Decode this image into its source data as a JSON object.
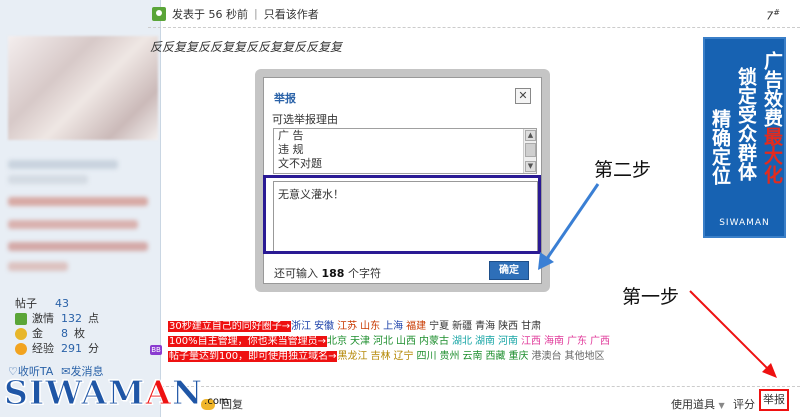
{
  "post": {
    "time_label": "发表于 56 秒前",
    "author_only": "只看该作者",
    "floor": "7",
    "floor_suffix": "#",
    "content": "反反复复反反复复反反复复反反复复"
  },
  "user": {
    "stats": [
      {
        "label": "帖子",
        "value": "43",
        "unit": "",
        "icon": "none"
      },
      {
        "label": "激情",
        "value": "132",
        "unit": "点",
        "icon": "sprout-icon"
      },
      {
        "label": "金",
        "value": "8",
        "unit": "枚",
        "icon": "gold-coin-icon"
      },
      {
        "label": "经验",
        "value": "291",
        "unit": "分",
        "icon": "experience-icon"
      }
    ],
    "collect_label": "收听TA",
    "message_label": "发消息"
  },
  "dialog": {
    "title": "举报",
    "close": "✕",
    "hint": "可选举报理由",
    "reasons": [
      "广 告",
      "违 规",
      "文不对题"
    ],
    "comment": "无意义灌水！",
    "remaining_prefix": "还可输入",
    "remaining_count": "188",
    "remaining_suffix": "个字符",
    "confirm": "确定"
  },
  "annotations": {
    "step2": "第二步",
    "step1": "第一步"
  },
  "ad": {
    "col_left": "精确定位",
    "col_mid": "锁定受众群体",
    "col_right_a": "广告效费",
    "col_right_b": "最大化",
    "brand": "SIWAMAN"
  },
  "promo": {
    "line1_tag": "30秒建立自己的同好圈子→",
    "line1_places": [
      {
        "t": "浙江",
        "color": "#1a3fa8"
      },
      {
        "t": "安徽",
        "color": "#1a3fa8"
      },
      {
        "t": "江苏",
        "color": "#c83a00"
      },
      {
        "t": "山东",
        "color": "#c83a00"
      },
      {
        "t": "上海",
        "color": "#1a3fa8"
      },
      {
        "t": "福建",
        "color": "#c83a00"
      },
      {
        "t": "宁夏",
        "color": "#333333"
      },
      {
        "t": "新疆",
        "color": "#333333"
      },
      {
        "t": "青海",
        "color": "#333333"
      },
      {
        "t": "陕西",
        "color": "#333333"
      },
      {
        "t": "甘肃",
        "color": "#333333"
      }
    ],
    "line2_tag": "100%自主管理，你也来当管理员→",
    "line2_places": [
      {
        "t": "北京",
        "color": "#1f8f2f"
      },
      {
        "t": "天津",
        "color": "#1f8f2f"
      },
      {
        "t": "河北",
        "color": "#1f8f2f"
      },
      {
        "t": "山西",
        "color": "#1f8f2f"
      },
      {
        "t": "内蒙古",
        "color": "#1f8f2f"
      },
      {
        "t": "湖北",
        "color": "#19a6a6"
      },
      {
        "t": "湖南",
        "color": "#19a6a6"
      },
      {
        "t": "河南",
        "color": "#19a6a6"
      },
      {
        "t": "江西",
        "color": "#e0399a"
      },
      {
        "t": "海南",
        "color": "#e0399a"
      },
      {
        "t": "广东",
        "color": "#e0399a"
      },
      {
        "t": "广西",
        "color": "#e0399a"
      }
    ],
    "line3_tag": "帖子量达到100，即可使用独立域名→",
    "line3_places": [
      {
        "t": "黑龙江",
        "color": "#b38600"
      },
      {
        "t": "吉林",
        "color": "#b38600"
      },
      {
        "t": "辽宁",
        "color": "#b38600"
      },
      {
        "t": "四川",
        "color": "#1f8f2f"
      },
      {
        "t": "贵州",
        "color": "#1f8f2f"
      },
      {
        "t": "云南",
        "color": "#1f8f2f"
      },
      {
        "t": "西藏",
        "color": "#1f8f2f"
      },
      {
        "t": "重庆",
        "color": "#1f8f2f"
      },
      {
        "t": "港澳台",
        "color": "#666666"
      },
      {
        "t": "其他地区",
        "color": "#666666"
      }
    ],
    "badge": "BB"
  },
  "bottom": {
    "reply": "回复",
    "tools": "使用道具",
    "rate": "评分",
    "report": "举报"
  },
  "watermark": {
    "text_a": "SIWA",
    "text_b": "M",
    "text_c": "A",
    "text_d": "N",
    "suffix": ".com"
  },
  "colors": {
    "accent": "#2a62a8",
    "highlight_box": "#2a1a94",
    "report_box": "#ee1111"
  }
}
